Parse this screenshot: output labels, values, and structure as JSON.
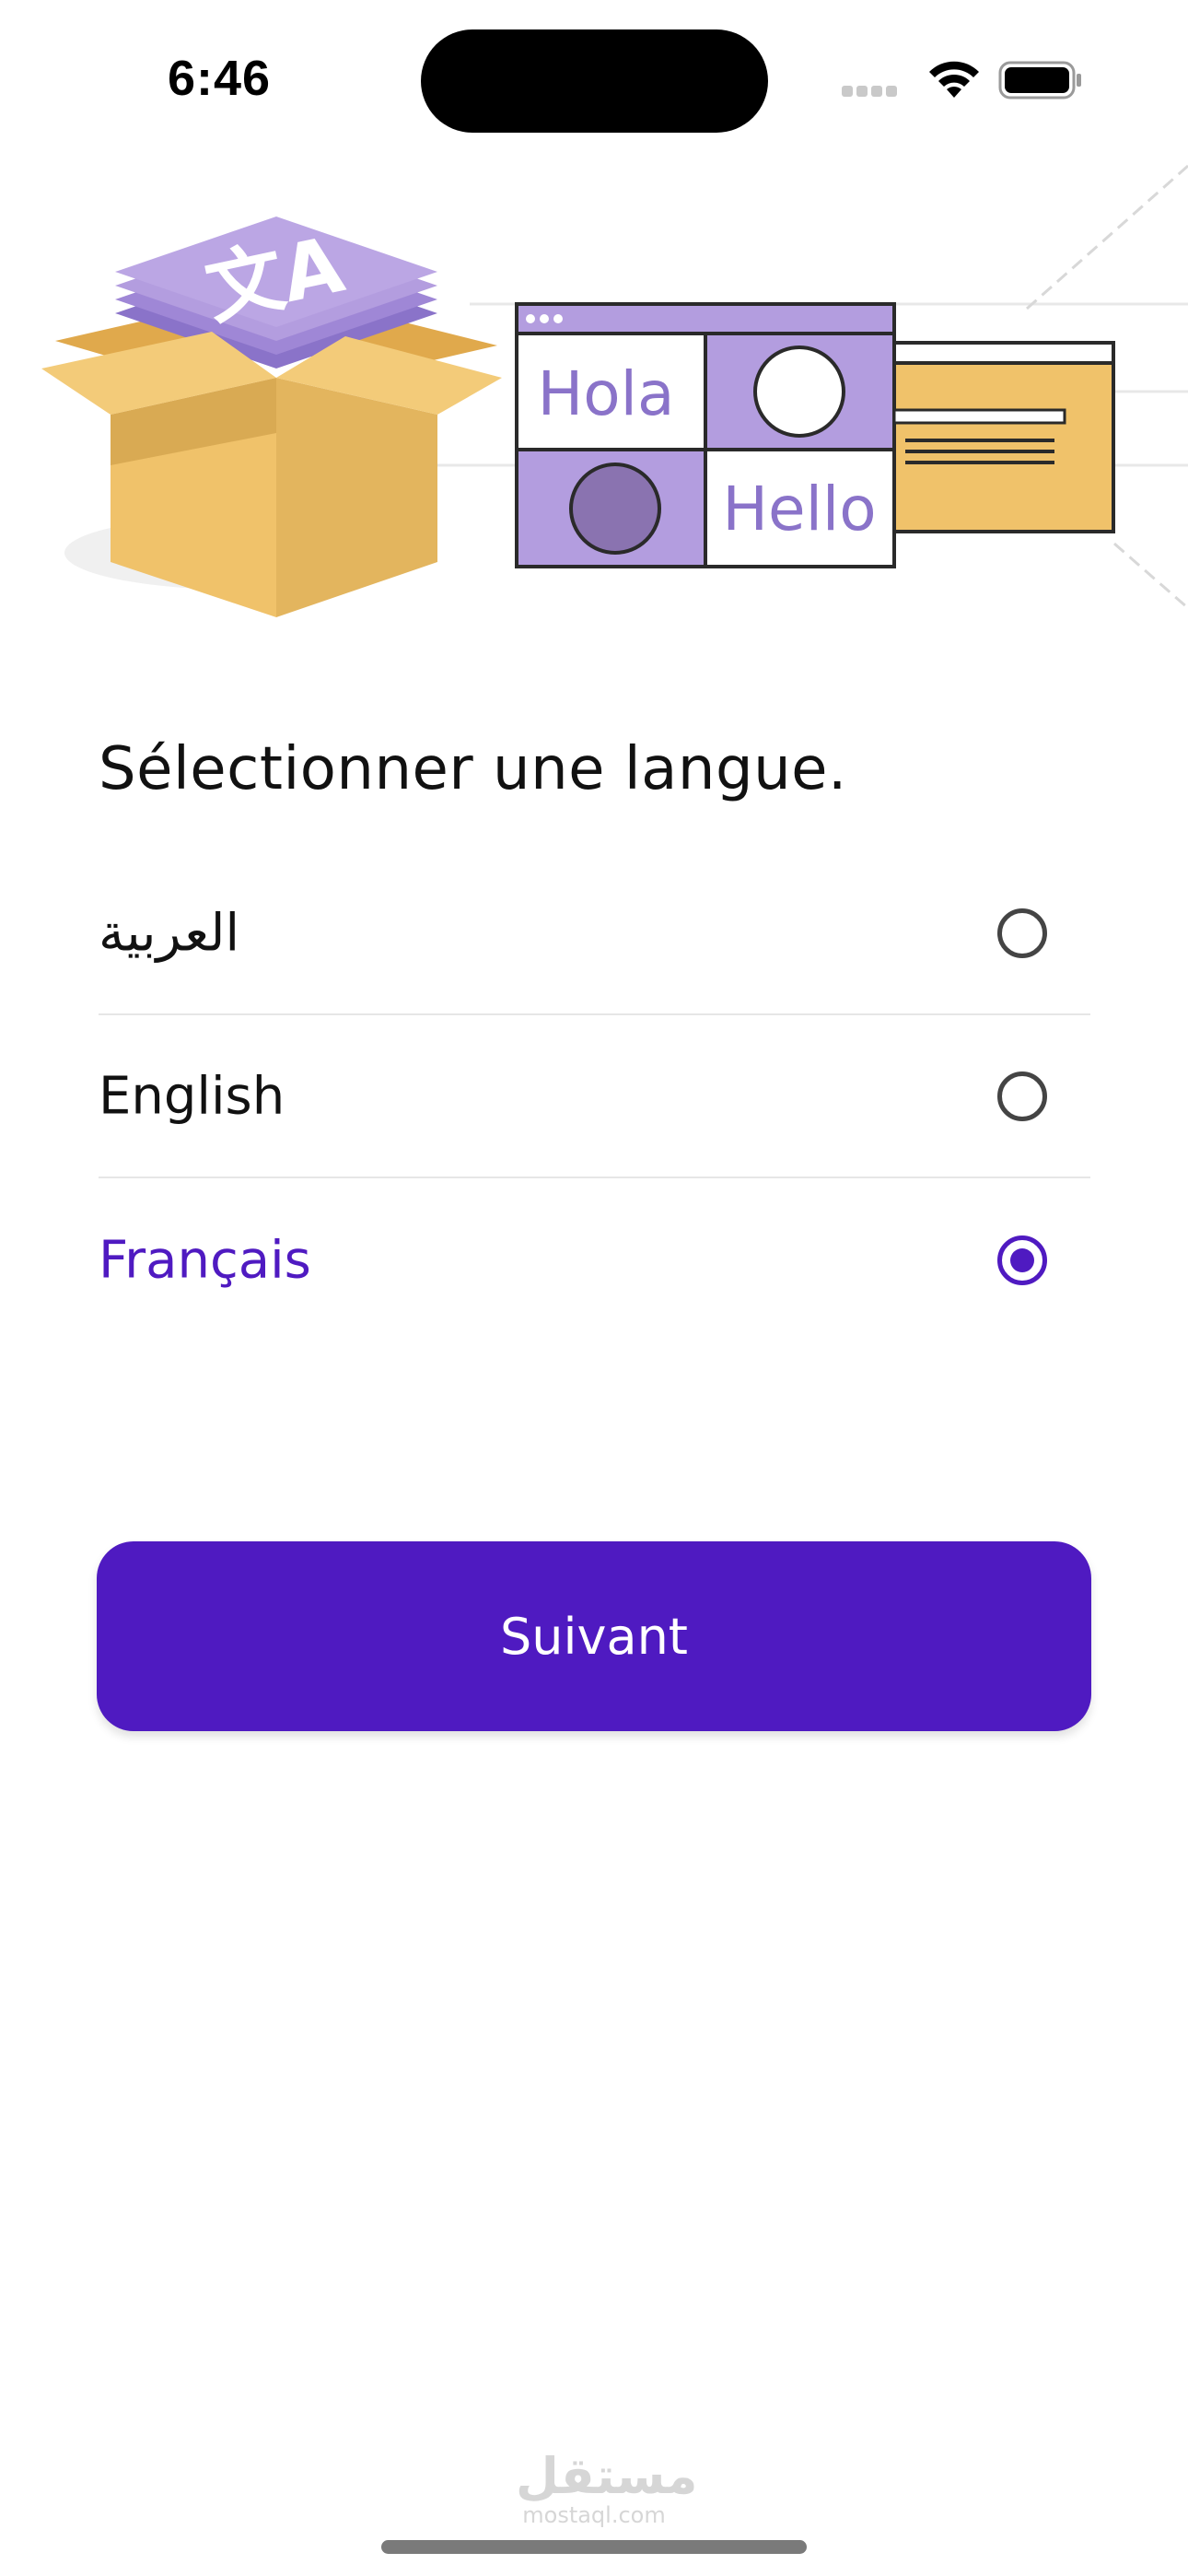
{
  "status_bar": {
    "time": "6:46",
    "icons": [
      "cellular-signal-icon",
      "wifi-icon",
      "battery-icon"
    ]
  },
  "illustration": {
    "box_glyph": "文A",
    "card_texts": [
      "Hola",
      "Hello"
    ]
  },
  "title": "Sélectionner une langue.",
  "languages": [
    {
      "label": "العربية",
      "selected": false
    },
    {
      "label": "English",
      "selected": false
    },
    {
      "label": "Français",
      "selected": true
    }
  ],
  "next_button": {
    "label": "Suivant"
  },
  "watermark": {
    "main": "مستقل",
    "sub": "mostaql.com"
  },
  "colors": {
    "accent": "#4f1ac1",
    "illustration_purple": "#b39ddf",
    "illustration_yellow": "#f0c26a",
    "text": "#111111",
    "divider": "#e6e6e6"
  }
}
